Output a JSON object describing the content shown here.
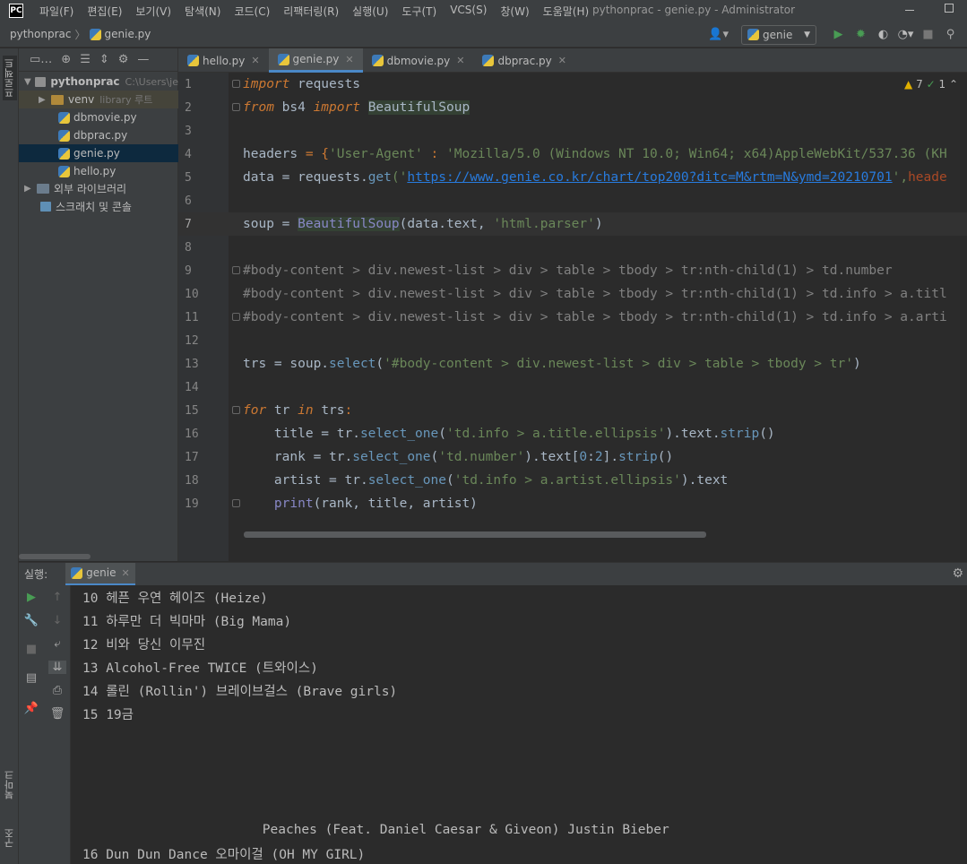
{
  "window": {
    "logo": "PC",
    "title": "pythonprac - genie.py - Administrator"
  },
  "menu": [
    "파일(F)",
    "편집(E)",
    "보기(V)",
    "탐색(N)",
    "코드(C)",
    "리팩터링(R)",
    "실행(U)",
    "도구(T)",
    "VCS(S)",
    "창(W)",
    "도움말(H)"
  ],
  "breadcrumb": {
    "project": "pythonprac",
    "file": "genie.py"
  },
  "toolbar": {
    "run_config": "genie"
  },
  "left_strip": {
    "project": "프로젝트",
    "bookmarks": "북마크",
    "structure": "구조"
  },
  "project_tree": {
    "root": "pythonprac",
    "root_path": "C:\\Users\\je",
    "venv": "venv",
    "venv_hint": "library 루트",
    "files": [
      "dbmovie.py",
      "dbprac.py",
      "genie.py",
      "hello.py"
    ],
    "external": "외부 라이브러리",
    "scratches": "스크래치 및 콘솔"
  },
  "tabs": [
    "hello.py",
    "genie.py",
    "dbmovie.py",
    "dbprac.py"
  ],
  "inspections": {
    "warnings": "7",
    "weak": "1"
  },
  "code": {
    "line_numbers": [
      "1",
      "2",
      "3",
      "4",
      "5",
      "6",
      "7",
      "8",
      "9",
      "10",
      "11",
      "12",
      "13",
      "14",
      "15",
      "16",
      "17",
      "18",
      "19"
    ],
    "l1_kw": "import",
    "l1_rest": " requests",
    "l2_from": "from",
    "l2_mod": " bs4 ",
    "l2_import": "import",
    "l2_name": "BeautifulSoup",
    "l4_a": "headers",
    "l4_b": " = {",
    "l4_c": "'User-Agent'",
    "l4_d": " : ",
    "l4_e": "'Mozilla/5.0 (Windows NT 10.0; Win64; x64)AppleWebKit/537.36 (KH",
    "l5_a": "data = requests.",
    "l5_b": "get",
    "l5_c": "('",
    "l5_url": "https://www.genie.co.kr/chart/top200?ditc=M&rtm=N&ymd=20210701",
    "l5_d": "',",
    "l5_e": "heade",
    "l7_a": "soup = ",
    "l7_b": "BeautifulSoup",
    "l7_c": "(data.text, ",
    "l7_d": "'html.parser'",
    "l7_e": ")",
    "l9": "#body-content > div.newest-list > div > table > tbody > tr:nth-child(1) > td.number",
    "l10": "#body-content > div.newest-list > div > table > tbody > tr:nth-child(1) > td.info > a.titl",
    "l11": "#body-content > div.newest-list > div > table > tbody > tr:nth-child(1) > td.info > a.arti",
    "l13_a": "trs = soup.",
    "l13_b": "select",
    "l13_c": "(",
    "l13_d": "'#body-content > div.newest-list > div > table > tbody > tr'",
    "l13_e": ")",
    "l15_a": "for",
    "l15_b": " tr ",
    "l15_c": "in",
    "l15_d": " trs",
    "l15_e": ":",
    "l16_a": "    title = tr.",
    "l16_b": "select_one",
    "l16_c": "(",
    "l16_d": "'td.info > a.title.ellipsis'",
    "l16_e": ").text.",
    "l16_f": "strip",
    "l16_g": "()",
    "l17_a": "    rank = tr.",
    "l17_b": "select_one",
    "l17_c": "(",
    "l17_d": "'td.number'",
    "l17_e": ").text[",
    "l17_f": "0",
    "l17_g": ":",
    "l17_h": "2",
    "l17_i": "].",
    "l17_j": "strip",
    "l17_k": "()",
    "l18_a": "    artist = tr.",
    "l18_b": "select_one",
    "l18_c": "(",
    "l18_d": "'td.info > a.artist.ellipsis'",
    "l18_e": ").text",
    "l19_a": "    ",
    "l19_b": "print",
    "l19_c": "(rank, title, artist)"
  },
  "run": {
    "label": "실행:",
    "tab": "genie",
    "output": [
      "10 헤픈 우연 헤이즈 (Heize)",
      "11 하루만 더 빅마마 (Big Mama)",
      "12 비와 당신 이무진",
      "13 Alcohol-Free TWICE (트와이스)",
      "14 롤린 (Rollin') 브레이브걸스 (Brave girls)",
      "15 19금",
      "",
      "",
      "",
      "",
      "                       Peaches (Feat. Daniel Caesar & Giveon) Justin Bieber",
      "16 Dun Dun Dance 오마이걸 (OH MY GIRL)"
    ]
  }
}
